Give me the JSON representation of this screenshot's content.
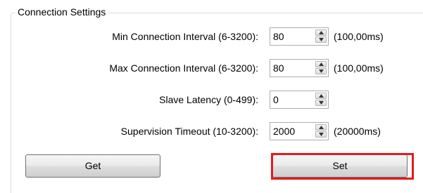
{
  "group": {
    "title": "Connection Settings"
  },
  "fields": [
    {
      "label": "Min Connection Interval (6-3200):",
      "value": "80",
      "unit": "(100,00ms)"
    },
    {
      "label": "Max Connection Interval (6-3200):",
      "value": "80",
      "unit": "(100,00ms)"
    },
    {
      "label": "Slave Latency (0-499):",
      "value": "0",
      "unit": ""
    },
    {
      "label": "Supervision Timeout (10-3200):",
      "value": "2000",
      "unit": "(20000ms)"
    }
  ],
  "buttons": {
    "get_label": "Get",
    "set_label": "Set"
  },
  "icons": {
    "spin_up": "chevron-up-icon",
    "spin_down": "chevron-down-icon"
  },
  "colors": {
    "highlight": "#e41b1b",
    "groupbox_border": "#d5dfe5",
    "field_border": "#abadb3"
  }
}
